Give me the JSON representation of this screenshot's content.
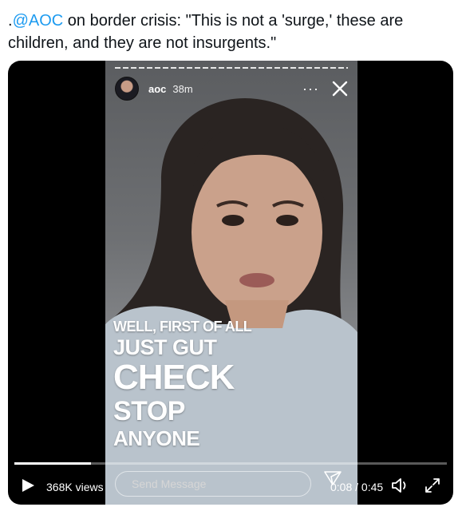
{
  "tweet": {
    "prefix": ".",
    "mention": "@AOC",
    "text_after_mention": " on border crisis: \"This is not a 'surge,' these are children, and they are not insurgents.\""
  },
  "story": {
    "username": "aoc",
    "posted_ago": "38m",
    "more_label": "···",
    "caption_lines": [
      "WELL, FIRST OF ALL",
      "JUST GUT",
      "CHECK",
      "STOP",
      "ANYONE"
    ]
  },
  "player": {
    "views": "368K views",
    "send_placeholder": "Send Message",
    "current_time": "0:08",
    "separator": " / ",
    "duration": "0:45",
    "progress_fraction": 0.178
  },
  "colors": {
    "mention": "#1d9bf0",
    "player_bg": "#000000",
    "text": "#0f1419"
  },
  "icons": {
    "close": "close-icon",
    "more": "more-icon",
    "play": "play-icon",
    "send": "send-icon",
    "volume": "volume-icon",
    "expand": "expand-icon"
  }
}
